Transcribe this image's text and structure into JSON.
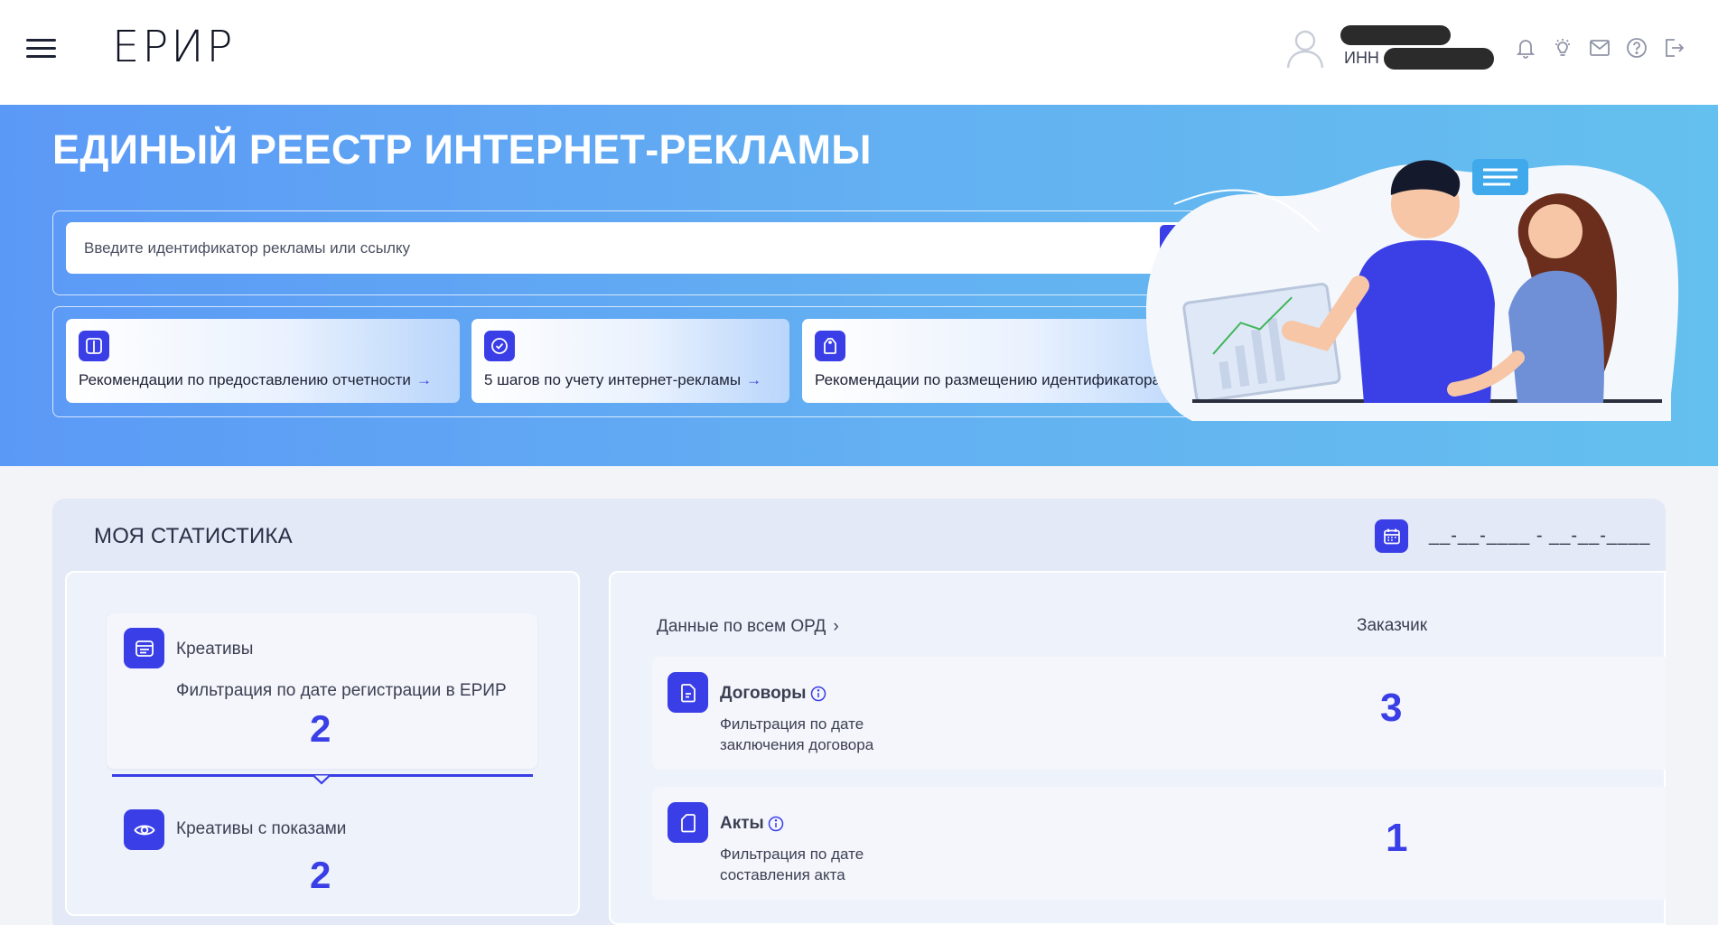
{
  "header": {
    "logo": "ЕРИР",
    "inn_label": "ИНН",
    "icons": [
      "bell-icon",
      "lightbulb-icon",
      "mail-icon",
      "help-icon",
      "logout-icon"
    ]
  },
  "hero": {
    "title": "ЕДИНЫЙ РЕЕСТР ИНТЕРНЕТ-РЕКЛАМЫ",
    "search": {
      "placeholder": "Введите идентификатор рекламы или ссылку",
      "value": ""
    },
    "links": [
      {
        "label": "Рекомендации по предоставлению отчетности",
        "icon": "book-icon"
      },
      {
        "label": "5 шагов по учету интернет-рекламы",
        "icon": "check-circle-icon"
      },
      {
        "label": "Рекомендации по размещению идентификатора",
        "icon": "tag-icon"
      }
    ]
  },
  "stats": {
    "title": "МОЯ СТАТИСТИКА",
    "date_range": "__-__-____ - __-__-____",
    "creatives": {
      "label": "Креативы",
      "filter": "Фильтрация по дате регистрации в ЕРИР",
      "value": "2"
    },
    "creatives_shown": {
      "label": "Креативы с показами",
      "value": "2"
    },
    "ord_link": "Данные по всем ОРД",
    "column_header": "Заказчик",
    "rows": [
      {
        "title": "Договоры",
        "filter": "Фильтрация по дате заключения договора",
        "value": "3"
      },
      {
        "title": "Акты",
        "filter": "Фильтрация по дате составления акта",
        "value": "1"
      }
    ]
  },
  "colors": {
    "accent": "#3a3ee6",
    "hero_start": "#5b99f6",
    "hero_end": "#64c0ee",
    "panel": "#e3e9f6"
  }
}
